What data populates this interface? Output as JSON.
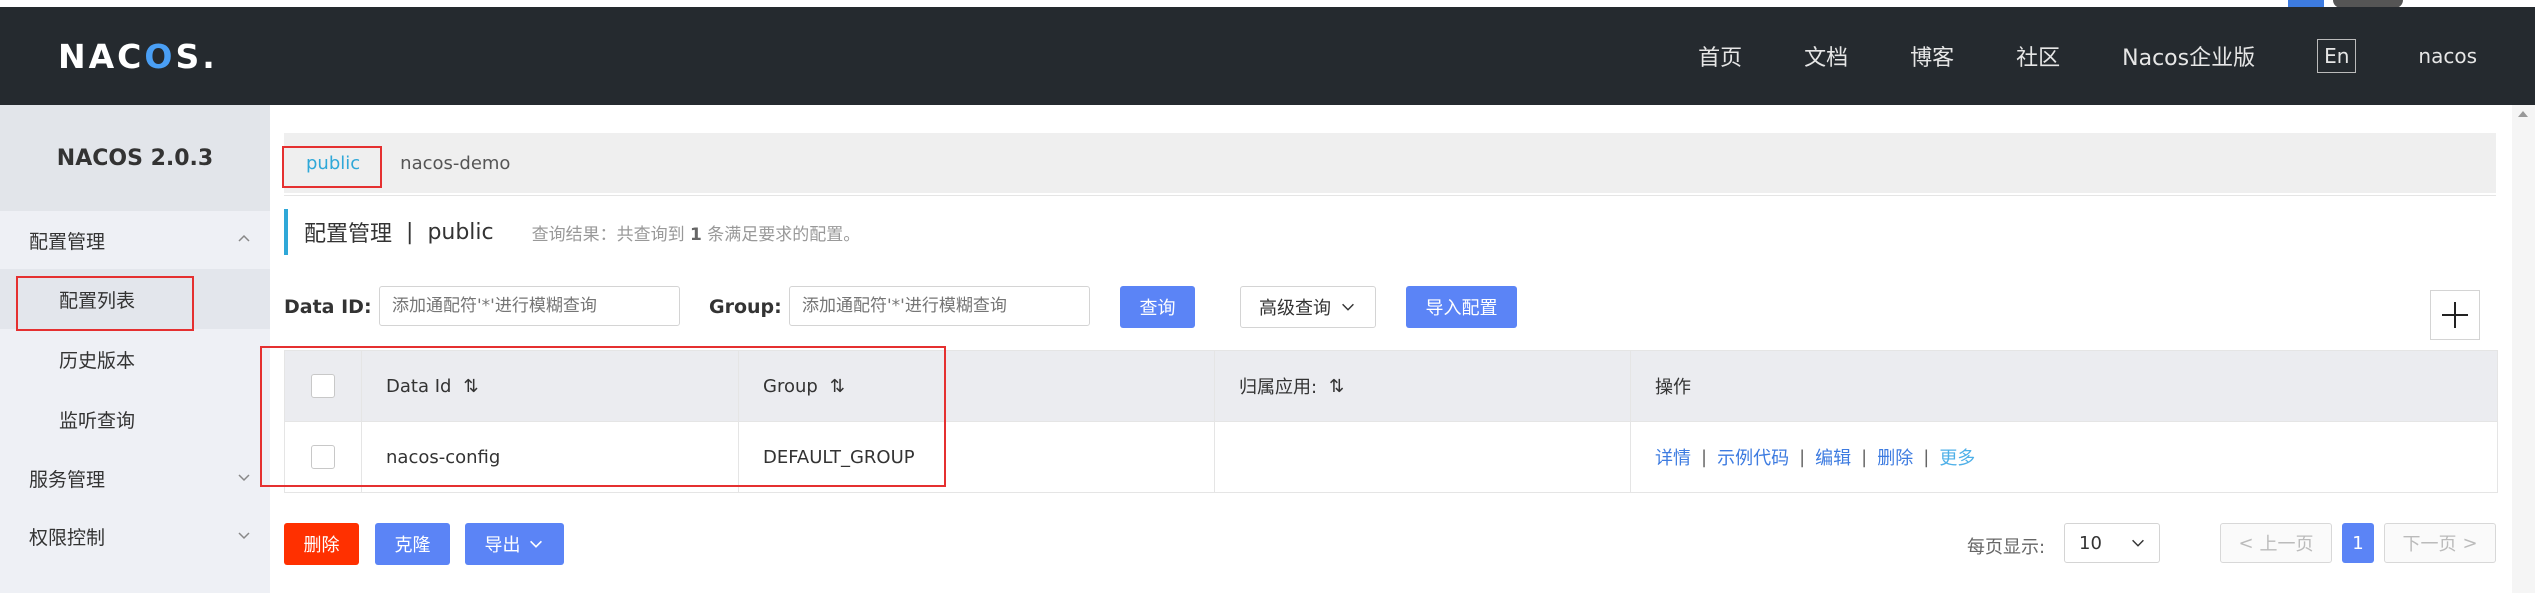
{
  "header": {
    "logo": "NACOS.",
    "nav": [
      "首页",
      "文档",
      "博客",
      "社区",
      "Nacos企业版"
    ],
    "lang_button": "En",
    "user": "nacos"
  },
  "sidebar": {
    "version": "NACOS 2.0.3",
    "groups": [
      {
        "label": "配置管理",
        "expanded": true,
        "items": [
          "配置列表",
          "历史版本",
          "监听查询"
        ]
      },
      {
        "label": "服务管理",
        "expanded": false
      },
      {
        "label": "权限控制",
        "expanded": false
      }
    ],
    "active_item": "配置列表"
  },
  "namespaces": [
    "public",
    "nacos-demo"
  ],
  "active_namespace": "public",
  "title": {
    "section": "配置管理",
    "separator": "|",
    "namespace": "public",
    "hint_prefix": "查询结果：共查询到",
    "hint_count": "1",
    "hint_suffix": "条满足要求的配置。"
  },
  "filters": {
    "data_id_label": "Data ID:",
    "data_id_placeholder": "添加通配符'*'进行模糊查询",
    "group_label": "Group:",
    "group_placeholder": "添加通配符'*'进行模糊查询",
    "query_button": "查询",
    "advanced_button": "高级查询",
    "import_button": "导入配置"
  },
  "table": {
    "columns": [
      "Data Id",
      "Group",
      "归属应用:",
      "操作"
    ],
    "rows": [
      {
        "data_id": "nacos-config",
        "group": "DEFAULT_GROUP",
        "app": ""
      }
    ],
    "actions": [
      "详情",
      "示例代码",
      "编辑",
      "删除",
      "更多"
    ]
  },
  "bottom": {
    "delete_button": "删除",
    "clone_button": "克隆",
    "export_button": "导出",
    "page_size_label": "每页显示:",
    "page_size": "10",
    "prev": "上一页",
    "page": "1",
    "next": "下一页"
  },
  "colors": {
    "header_bg": "#252a2f",
    "accent": "#2fa8d8",
    "primary": "#5b84f6",
    "danger": "#ff3000",
    "annotation": "#e53030"
  }
}
